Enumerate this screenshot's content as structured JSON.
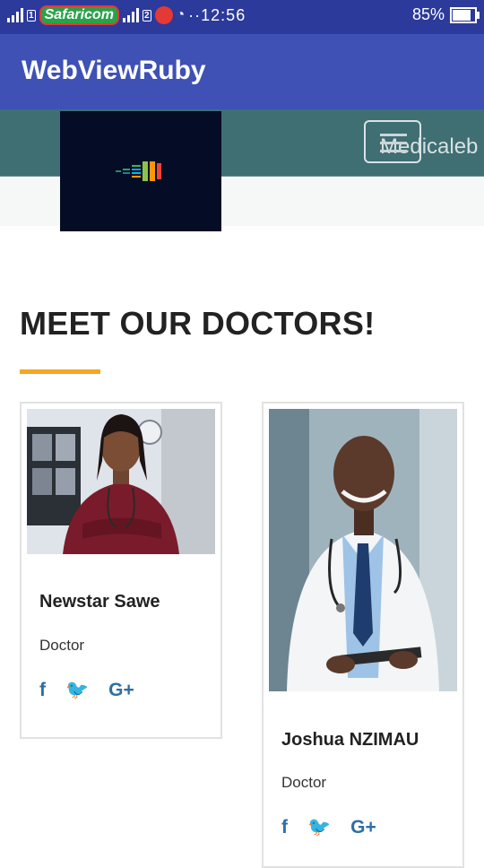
{
  "status_bar": {
    "carrier": "Safaricom",
    "sim1": "1",
    "sim2": "2",
    "time": "··12:56",
    "battery": "85%",
    "battery_level": 0.85
  },
  "app": {
    "title": "WebViewRuby"
  },
  "site": {
    "brand": "Medicaleb"
  },
  "section": {
    "title": "MEET OUR DOCTORS!"
  },
  "doctors": [
    {
      "name": "Newstar Sawe",
      "role": "Doctor",
      "socials": [
        "f",
        "🐦",
        "G+"
      ]
    },
    {
      "name": "Joshua NZIMAU",
      "role": "Doctor",
      "socials": [
        "f",
        "🐦",
        "G+"
      ]
    }
  ],
  "colors": {
    "status_bar": "#2c3a9b",
    "app_bar": "#3f51b5",
    "site_nav": "#3f6e73",
    "accent_line": "#f5a623",
    "social_icon": "#2f6ea5"
  }
}
